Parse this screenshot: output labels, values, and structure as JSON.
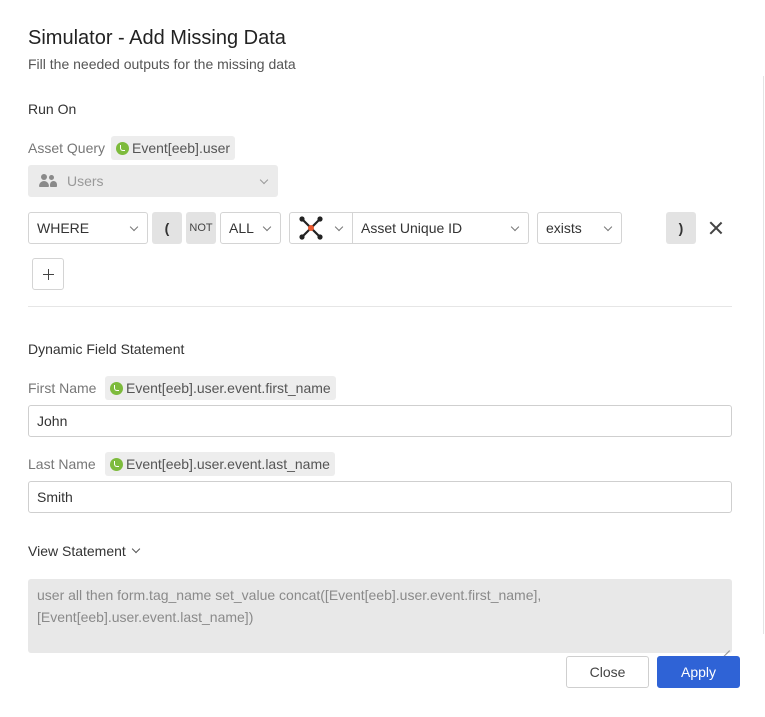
{
  "dialog": {
    "title": "Simulator - Add Missing Data",
    "subtitle": "Fill the needed outputs for the missing data"
  },
  "run_on": {
    "section_label": "Run On",
    "asset_query_label": "Asset Query",
    "asset_query_chip": "Event[eeb].user",
    "asset_type_value": "Users"
  },
  "condition": {
    "operator": "WHERE",
    "open_paren": "(",
    "not_label": "NOT",
    "quantifier": "ALL",
    "source_icon": "network-nodes-icon",
    "field": "Asset Unique ID",
    "comparison": "exists",
    "close_paren": ")"
  },
  "dynamic_field": {
    "section_label": "Dynamic Field Statement",
    "first_name_label": "First Name",
    "first_name_chip": "Event[eeb].user.event.first_name",
    "first_name_value": "John",
    "last_name_label": "Last Name",
    "last_name_chip": "Event[eeb].user.event.last_name",
    "last_name_value": "Smith"
  },
  "statement": {
    "toggle_label": "View Statement",
    "text": "user all then form.tag_name set_value concat([Event[eeb].user.event.first_name], [Event[eeb].user.event.last_name])"
  },
  "footer": {
    "close_label": "Close",
    "apply_label": "Apply"
  },
  "colors": {
    "primary": "#2f63d6",
    "chip_icon": "#7dbb3c",
    "network_icon_accent": "#e8572e"
  }
}
